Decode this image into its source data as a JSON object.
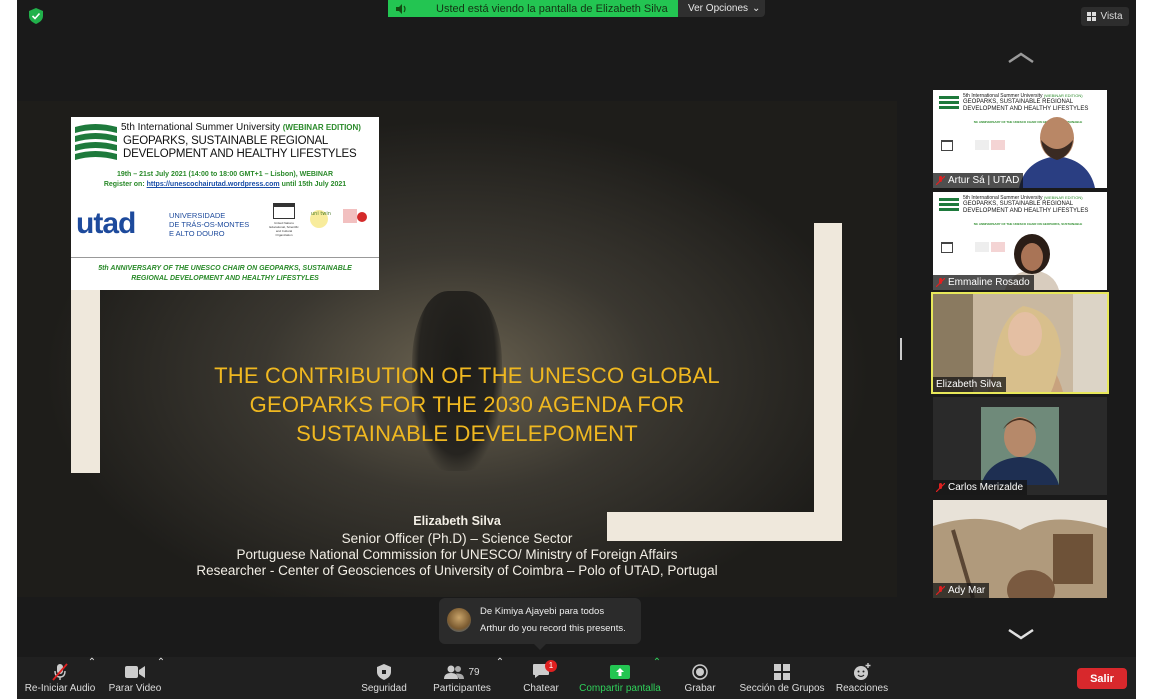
{
  "banner": {
    "viewing_text": "Usted está viendo la pantalla de Elizabeth Silva",
    "options_label": "Ver Opciones"
  },
  "view_button": {
    "label": "Vista"
  },
  "slide": {
    "header_line1": "5th International Summer University",
    "header_edition": "(WEBINAR EDITION)",
    "header_line2a": "GEOPARKS, SUSTAINABLE REGIONAL",
    "header_line2b": "DEVELOPMENT AND HEALTHY LIFESTYLES",
    "dates": "19th – 21st July 2021 (14:00 to 18:00 GMT+1 – Lisbon), WEBINAR",
    "register_prefix": "Register on:",
    "register_url": "https://unescochairutad.wordpress.com",
    "register_suffix": "until 15th July 2021",
    "utad": "utad",
    "univ_line1": "UNIVERSIDADE",
    "univ_line2": "DE TRÁS-OS-MONTES",
    "univ_line3": "E ALTO DOURO",
    "unesco_caption": "United Nations Educational, Scientific and Cultural Organization",
    "anniv_line1": "5th ANNIVERSARY OF THE UNESCO CHAIR ON GEOPARKS, SUSTAINABLE",
    "anniv_line2": "REGIONAL DEVELOPMENT AND HEALTHY LIFESTYLES",
    "title_line1": "THE CONTRIBUTION OF THE UNESCO GLOBAL",
    "title_line2": "GEOPARKS FOR THE 2030 AGENDA FOR",
    "title_line3": "SUSTAINABLE DEVELEPOMENT",
    "speaker_name": "Elizabeth Silva",
    "role_line1": "Senior Officer (Ph.D) – Science Sector",
    "role_line2": "Portuguese National Commission for UNESCO/ Ministry of Foreign Affairs",
    "role_line3": "Researcher - Center of Geosciences of University of Coimbra – Polo of UTAD, Portugal"
  },
  "participants": [
    {
      "name": "Artur Sá | UTAD",
      "muted": true
    },
    {
      "name": "Emmaline Rosado",
      "muted": true
    },
    {
      "name": "Elizabeth Silva",
      "muted": false,
      "active": true
    },
    {
      "name": "Carlos Merizalde",
      "muted": true
    },
    {
      "name": "Ady Mar",
      "muted": true
    }
  ],
  "chat_toast": {
    "from": "De Kimiya Ajayebi para todos",
    "message": "Arthur do you record this presents."
  },
  "toolbar": {
    "audio_label": "Re-Iniciar Audio",
    "video_label": "Parar Video",
    "security_label": "Seguridad",
    "participants_label": "Participantes",
    "participants_count": "79",
    "chat_label": "Chatear",
    "chat_badge": "1",
    "share_label": "Compartir pantalla",
    "record_label": "Grabar",
    "breakout_label": "Sección de Grupos",
    "reactions_label": "Reacciones",
    "leave_label": "Salir"
  },
  "colors": {
    "share_green": "#23c552",
    "title_gold": "#f0b820",
    "leave_red": "#d8282c",
    "active_border": "#e8e85a"
  }
}
